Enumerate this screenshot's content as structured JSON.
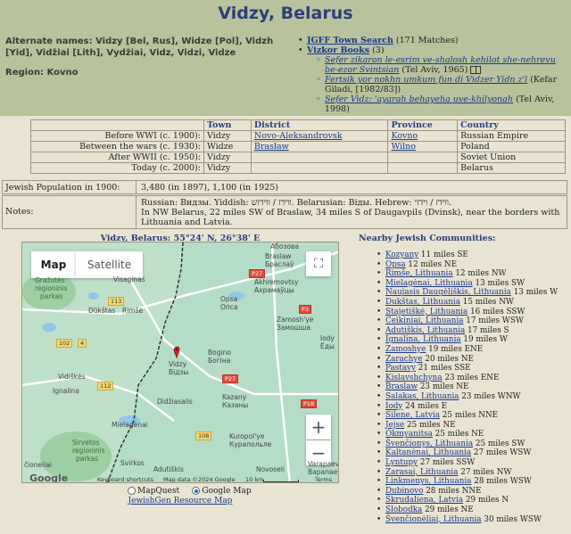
{
  "page": {
    "title": "Vidzy, Belarus"
  },
  "header": {
    "alternate_names": "Alternate names: Vidzy [Bel, Rus], Widze [Pol], Vidzh [Yid], Vidžiai [Lith], Vydžiai, Vidz, Vidzi, Vidze",
    "region": "Region: Kovno"
  },
  "links": {
    "jgff_label": "JGFF Town Search",
    "jgff_count": " (171 Matches)",
    "yizkor_label": "Vizkor Books",
    "yizkor_count": " (3)",
    "books": [
      {
        "title": "Sefer zikaron le-esrim ve-shalosh kehilot she-nehrevu be-ezor Svintsian",
        "info": " (Tel Aviv, 1965)"
      },
      {
        "title": "Fertsik yor nokhn umkum fun di Vidzer Yidn z'l",
        "info": " (Kefar Giladi, [1982/83])"
      },
      {
        "title": "Sefer Vidz: 'ayarah behayeha uve-khilyonah",
        "info": " (Tel Aviv, 1998)"
      }
    ]
  },
  "towns_table": {
    "headers": [
      "",
      "Town",
      "District",
      "Province",
      "Country"
    ],
    "rows": [
      {
        "era": "Before WWI (c. 1900):",
        "town": "Vidzy",
        "district": "Novo-Aleksandrovsk",
        "province": "Kovno",
        "country": "Russian Empire"
      },
      {
        "era": "Between the wars (c. 1930):",
        "town": "Widze",
        "district": "Brasław",
        "province": "Wilno",
        "country": "Poland"
      },
      {
        "era": "After WWII (c. 1950):",
        "town": "Vidzy",
        "district": "",
        "province": "",
        "country": "Soviet Union"
      },
      {
        "era": "Today (c. 2000):",
        "town": "Vidzy",
        "district": "",
        "province": "",
        "country": "Belarus"
      }
    ]
  },
  "population": {
    "label": "Jewish Population in 1900:",
    "value": "3,480 (in 1897), 1,100 (in 1925)"
  },
  "notes": {
    "label": "Notes:",
    "line1": "Russian: Видзы. Yiddish: ווידז / ווידזש. Belarusian: Віды. Hebrew: ווידז / וידזי.",
    "line2": "In NW Belarus, 22 miles SW of Braslaw, 34 miles S of Daugavpils (Dvinsk), near the borders with Lithuania and Latvia."
  },
  "map": {
    "caption": "Vidzy, Belarus: 55°24' N, 26°38' E",
    "tab_map": "Map",
    "tab_satellite": "Satellite",
    "zoom_in": "+",
    "zoom_out": "−",
    "fullscreen": "⛶",
    "google": "Google",
    "kbd": "Keyboard shortcuts",
    "mapdata": "Map data ©2024 Google",
    "scale": "10 km",
    "terms": "Terms",
    "labels": {
      "vobozov": "Абозова",
      "braslaw": "Braslaw",
      "braslaw_ru": "Браслаў",
      "akhremovtsy": "Akhremovtsy",
      "akhremovtsy_ru": "Ахрамаўцы",
      "grazutes": "Gražutės",
      "grazutes2": "regioninis",
      "grazutes3": "parkas",
      "visaginas": "Visaginas",
      "dukstas": "Dūkštas",
      "rimse": "Rimšė",
      "opsa": "Opsa",
      "opsa_ru": "Опса",
      "zamosh": "Zamosh'ye",
      "zamosh_ru": "Замошша",
      "iody": "Iody",
      "iody_ru": "Ёды",
      "vidzy": "Vidzy",
      "vidzy_ru": "Відзы",
      "bogino": "Bogino",
      "bogino_ru": "Богіна",
      "vidiskes": "Vidiškės",
      "ignalina": "Ignalina",
      "didziasalis": "Didžiasalis",
      "kazany": "Kazany",
      "kazany_ru": "Казаны",
      "kuropol": "Kuropol'ye",
      "kuropol_ru": "Курапольле",
      "mielagenai": "Mielagėnai",
      "sirvetos": "Sirvetos",
      "sirvetos2": "regioninis",
      "sirvetos3": "parkas",
      "svirkos": "Svirkos",
      "adutiskis": "Adutiškis",
      "novoseli": "Novoseli",
      "varapaev": "Varapaev",
      "varapaev_ru": "Варапаеў",
      "cioneliai": "čioneliai"
    },
    "roads": {
      "p27a": "P27",
      "p27b": "P27",
      "p3": "P3",
      "p18": "P18",
      "r113": "113",
      "r102": "102",
      "r112": "112",
      "r4": "4",
      "r108": "108"
    },
    "marker": "red-pin"
  },
  "radios": {
    "mapquest": "MapQuest",
    "google": "Google Map",
    "selected": "Google Map"
  },
  "resource_link": "JewishGen Resource Map",
  "nearby": {
    "title": "Nearby Jewish Communities:",
    "items": [
      {
        "name": "Kozyany",
        "dist": " 11 miles SE"
      },
      {
        "name": "Opsa",
        "dist": " 12 miles NE"
      },
      {
        "name": "Rimše, Lithuania",
        "dist": " 12 miles NW"
      },
      {
        "name": "Mielagėnai, Lithuania",
        "dist": " 13 miles SW"
      },
      {
        "name": "Naujasis Daugėliškis, Lithuania",
        "dist": " 13 miles W"
      },
      {
        "name": "Dukštas, Lithuania",
        "dist": " 15 miles NW"
      },
      {
        "name": "Stajetiškė, Lithuania",
        "dist": " 16 miles SSW"
      },
      {
        "name": "Ceikiniai, Lithuania",
        "dist": " 17 miles WSW"
      },
      {
        "name": "Adutiškis, Lithuania",
        "dist": " 17 miles S"
      },
      {
        "name": "Ignalina, Lithuania",
        "dist": " 19 miles W"
      },
      {
        "name": "Zamoshye",
        "dist": " 19 miles ENE"
      },
      {
        "name": "Zarachye",
        "dist": " 20 miles NE"
      },
      {
        "name": "Pastavy",
        "dist": " 21 miles SSE"
      },
      {
        "name": "Kislavshchyna",
        "dist": " 23 miles ENE"
      },
      {
        "name": "Braslaw",
        "dist": " 23 miles NE"
      },
      {
        "name": "Salakas, Lithuania",
        "dist": " 23 miles WNW"
      },
      {
        "name": "Iody",
        "dist": " 24 miles E"
      },
      {
        "name": "Silene, Latvia",
        "dist": " 25 miles NNE"
      },
      {
        "name": "Jejse",
        "dist": " 25 miles NE"
      },
      {
        "name": "Okmyanitsa",
        "dist": " 25 miles NE"
      },
      {
        "name": "Švenčionys, Lithuania",
        "dist": " 25 miles SW"
      },
      {
        "name": "Kaltanėnai, Lithuania",
        "dist": " 27 miles WSW"
      },
      {
        "name": "Lyntupy",
        "dist": " 27 miles SSW"
      },
      {
        "name": "Zarasai, Lithuania",
        "dist": " 27 miles NW"
      },
      {
        "name": "Linkmenys, Lithuania",
        "dist": " 28 miles WSW"
      },
      {
        "name": "Dubinovo",
        "dist": " 28 miles NNE"
      },
      {
        "name": "Skrudaliena, Latvia",
        "dist": " 29 miles N"
      },
      {
        "name": "Slobodka",
        "dist": " 29 miles NE"
      },
      {
        "name": "Švenčionėliai, Lithuania",
        "dist": " 30 miles WSW"
      }
    ]
  },
  "colors": {
    "header_bg": "#b8c29c",
    "page_bg": "#e9e3d2",
    "title": "#2b3f7a",
    "link": "#1a3a8c",
    "map_water": "#a8d8c4"
  }
}
